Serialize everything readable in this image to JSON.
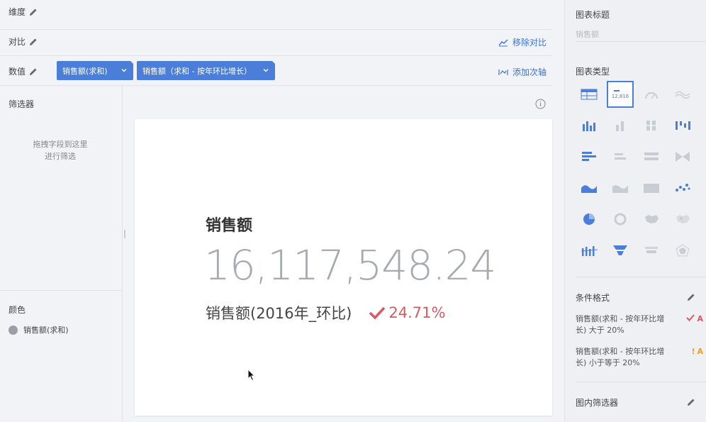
{
  "shelves": {
    "dimension_label": "维度",
    "compare_label": "对比",
    "compare_action": "移除对比",
    "value_label": "数值",
    "value_action": "添加次轴",
    "pills": [
      {
        "label": "销售额(求和)"
      },
      {
        "label": "销售额（求和 - 按年环比增长）"
      }
    ]
  },
  "filter": {
    "title": "筛选器",
    "hint_line1": "拖拽字段到这里",
    "hint_line2": "进行筛选"
  },
  "color": {
    "title": "颜色",
    "item": "销售额(求和)",
    "dot_color": "#9a9ea6"
  },
  "card": {
    "title": "销售额",
    "value": "16,117,548.24",
    "sub_label": "销售额(2016年_环比)",
    "sub_value": "24.71%",
    "accent": "#d85a60"
  },
  "right_panel": {
    "chart_title_label": "图表标题",
    "chart_title_placeholder": "销售额",
    "chart_type_label": "图表类型",
    "selected_type_text": "12,816",
    "cond_format_label": "条件格式",
    "cond_rules": [
      {
        "text": "销售额(求和 - 按年环比增长) 大于 20%",
        "icon": "check-icon",
        "letter": "A",
        "color": "#d85a60"
      },
      {
        "text": "销售额(求和 - 按年环比增长) 小于等于 20%",
        "icon": "exclamation-icon",
        "letter": "A",
        "color": "#f0a020"
      }
    ],
    "inner_filter_label": "图内筛选器"
  }
}
